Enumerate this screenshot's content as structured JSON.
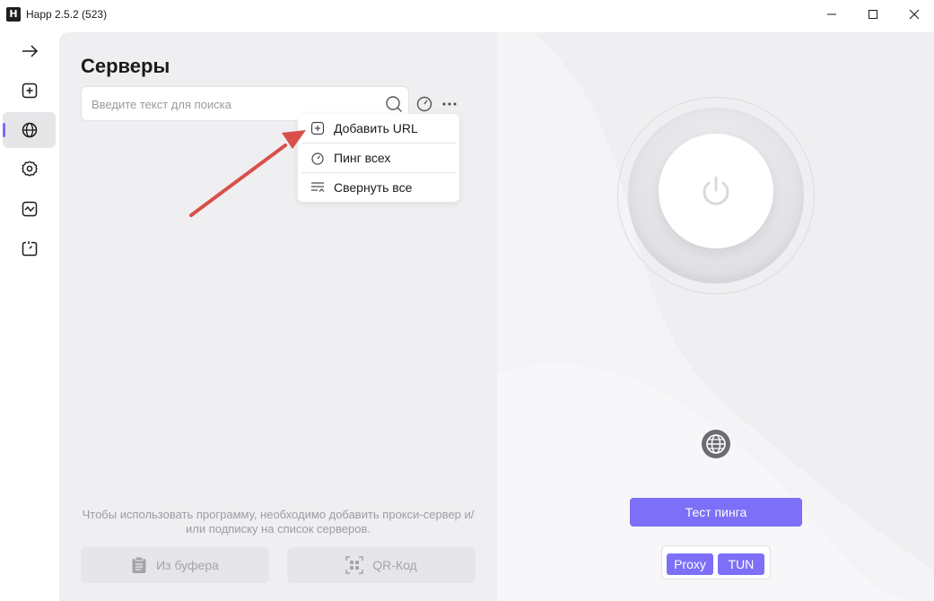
{
  "window": {
    "title": "Happ 2.5.2 (523)",
    "logo_glyph": "H"
  },
  "rail": {
    "items": [
      {
        "icon": "arrow-right-icon"
      },
      {
        "icon": "plus-square-icon"
      },
      {
        "icon": "globe-icon",
        "active": true
      },
      {
        "icon": "gear-icon"
      },
      {
        "icon": "activity-monitor-icon"
      },
      {
        "icon": "timer-icon"
      }
    ],
    "info_glyph": "i"
  },
  "servers": {
    "title": "Серверы",
    "search_placeholder": "Введите текст для поиска",
    "menu": {
      "add_url": "Добавить URL",
      "ping_all": "Пинг всех",
      "collapse_all": "Свернуть все"
    },
    "empty_hint": "Чтобы использовать программу, необходимо добавить прокси-сервер и/или подписку на список серверов.",
    "from_clipboard": "Из буфера",
    "qr_code": "QR-Код"
  },
  "connect": {
    "ping_test": "Тест пинга",
    "modes": {
      "proxy": "Proxy",
      "tun": "TUN"
    }
  },
  "colors": {
    "accent": "#7d6ff7",
    "annotation_arrow": "#d9504a"
  }
}
